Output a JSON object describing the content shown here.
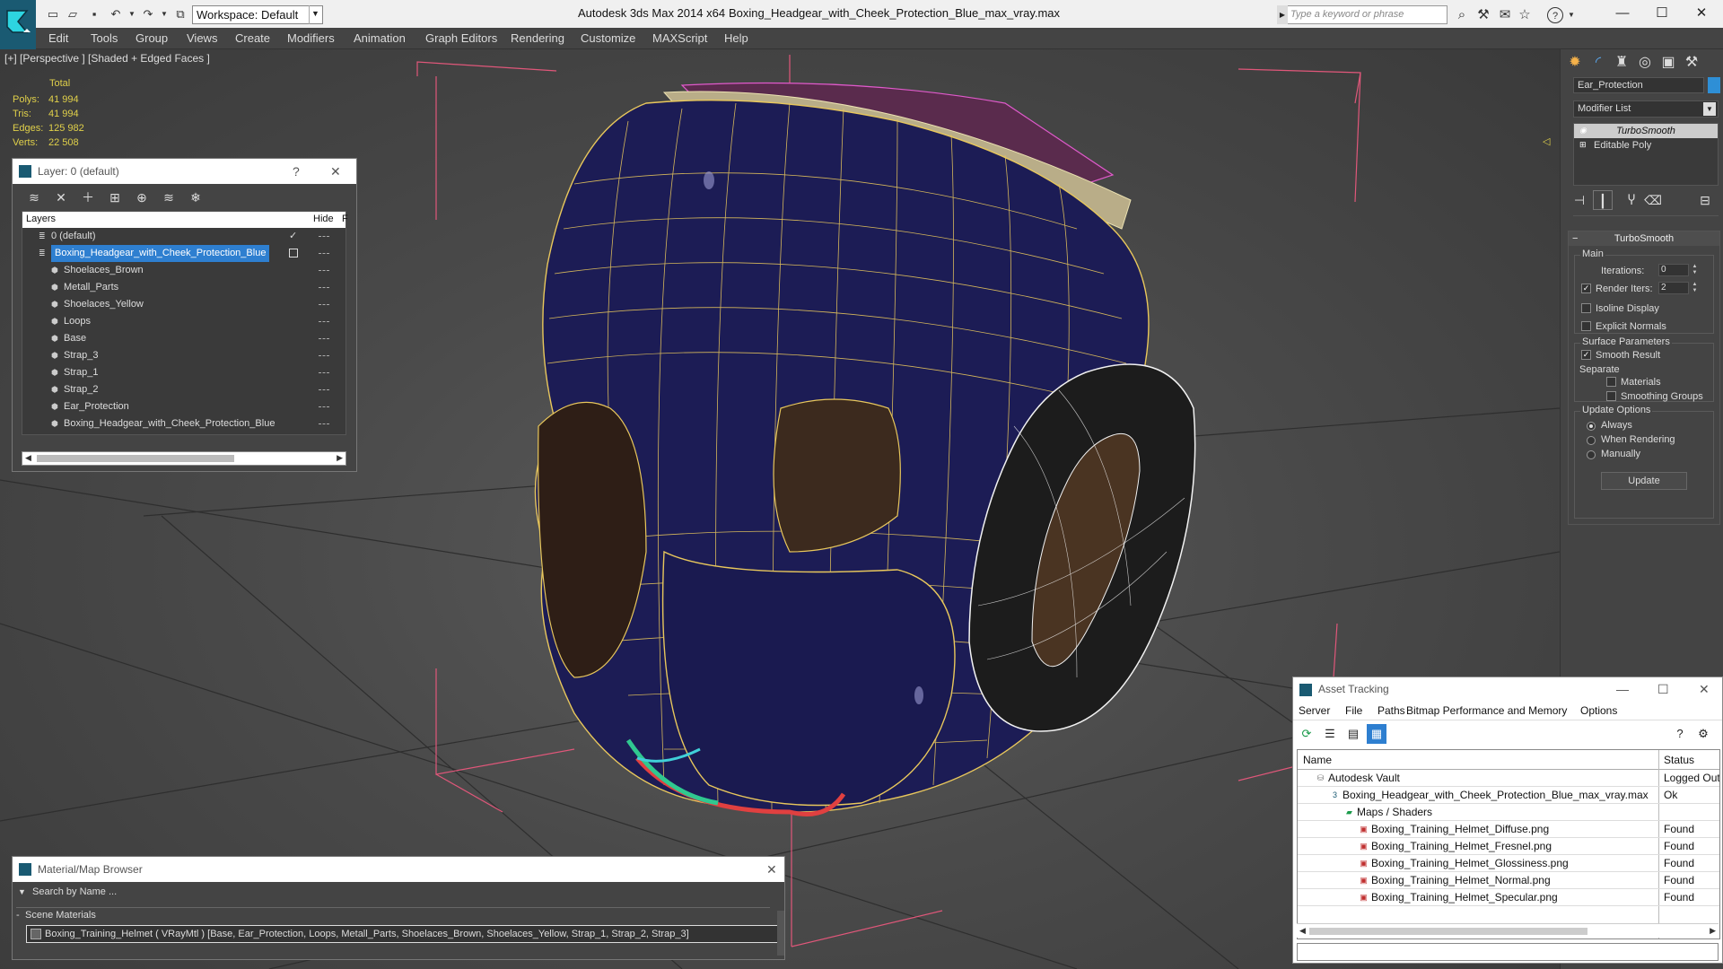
{
  "titlebar": {
    "workspace": "Workspace: Default",
    "app_title": "Autodesk 3ds Max  2014 x64",
    "doc_title": "Boxing_Headgear_with_Cheek_Protection_Blue_max_vray.max",
    "search_placeholder": "Type a keyword or phrase"
  },
  "menu": [
    "Edit",
    "Tools",
    "Group",
    "Views",
    "Create",
    "Modifiers",
    "Animation",
    "Graph Editors",
    "Rendering",
    "Customize",
    "MAXScript",
    "Help"
  ],
  "viewport": {
    "label": "[+] [Perspective ] [Shaded + Edged Faces ]",
    "stats_total": "Total",
    "stats": [
      {
        "label": "Polys:",
        "value": "41 994"
      },
      {
        "label": "Tris:",
        "value": "41 994"
      },
      {
        "label": "Edges:",
        "value": "125 982"
      },
      {
        "label": "Verts:",
        "value": "22 508"
      }
    ]
  },
  "command_panel": {
    "object_name": "Ear_Protection",
    "object_color": "#2e8fd6",
    "modifier_list": "Modifier List",
    "stack": [
      "TurboSmooth",
      "Editable Poly"
    ],
    "rollout_title": "TurboSmooth",
    "main_group": "Main",
    "iterations_label": "Iterations:",
    "iterations_value": "0",
    "render_iters_label": "Render Iters:",
    "render_iters_value": "2",
    "isoline": "Isoline Display",
    "explicit_normals": "Explicit Normals",
    "surface_group": "Surface Parameters",
    "smooth_result": "Smooth Result",
    "separate": "Separate",
    "materials": "Materials",
    "smoothing_groups": "Smoothing Groups",
    "update_group": "Update Options",
    "always": "Always",
    "when_rendering": "When Rendering",
    "manually": "Manually",
    "update_button": "Update"
  },
  "layer_window": {
    "title": "Layer: 0 (default)",
    "col_layers": "Layers",
    "col_hide": "Hide",
    "col_f": "F",
    "rows": [
      {
        "name": "0 (default)",
        "indent": 0,
        "type": "layer"
      },
      {
        "name": "Boxing_Headgear_with_Cheek_Protection_Blue",
        "indent": 0,
        "type": "layer",
        "selected": true
      },
      {
        "name": "Shoelaces_Brown",
        "indent": 1,
        "type": "object"
      },
      {
        "name": "Metall_Parts",
        "indent": 1,
        "type": "object"
      },
      {
        "name": "Shoelaces_Yellow",
        "indent": 1,
        "type": "object"
      },
      {
        "name": "Loops",
        "indent": 1,
        "type": "object"
      },
      {
        "name": "Base",
        "indent": 1,
        "type": "object"
      },
      {
        "name": "Strap_3",
        "indent": 1,
        "type": "object"
      },
      {
        "name": "Strap_1",
        "indent": 1,
        "type": "object"
      },
      {
        "name": "Strap_2",
        "indent": 1,
        "type": "object"
      },
      {
        "name": "Ear_Protection",
        "indent": 1,
        "type": "object"
      },
      {
        "name": "Boxing_Headgear_with_Cheek_Protection_Blue",
        "indent": 1,
        "type": "object"
      }
    ]
  },
  "material_browser": {
    "title": "Material/Map Browser",
    "search_placeholder": "Search by Name ...",
    "section": "Scene Materials",
    "item": "Boxing_Training_Helmet  ( VRayMtl ) [Base, Ear_Protection, Loops, Metall_Parts, Shoelaces_Brown, Shoelaces_Yellow, Strap_1, Strap_2, Strap_3]"
  },
  "asset_tracking": {
    "title": "Asset Tracking",
    "menu": [
      "Server",
      "File",
      "Paths",
      "Bitmap Performance and Memory",
      "Options"
    ],
    "col_name": "Name",
    "col_status": "Status",
    "rows": [
      {
        "name": "Autodesk Vault",
        "status": "Logged Out",
        "indent": 1
      },
      {
        "name": "Boxing_Headgear_with_Cheek_Protection_Blue_max_vray.max",
        "status": "Ok",
        "indent": 2
      },
      {
        "name": "Maps / Shaders",
        "status": "",
        "indent": 3
      },
      {
        "name": "Boxing_Training_Helmet_Diffuse.png",
        "status": "Found",
        "indent": 4
      },
      {
        "name": "Boxing_Training_Helmet_Fresnel.png",
        "status": "Found",
        "indent": 4
      },
      {
        "name": "Boxing_Training_Helmet_Glossiness.png",
        "status": "Found",
        "indent": 4
      },
      {
        "name": "Boxing_Training_Helmet_Normal.png",
        "status": "Found",
        "indent": 4
      },
      {
        "name": "Boxing_Training_Helmet_Specular.png",
        "status": "Found",
        "indent": 4
      }
    ]
  }
}
